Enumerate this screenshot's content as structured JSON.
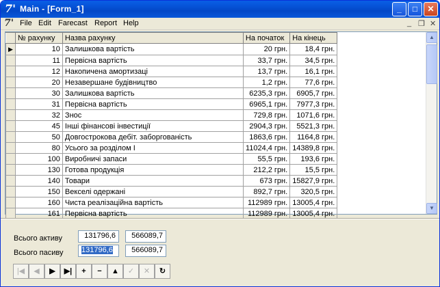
{
  "window": {
    "title": "Main - [Form_1]"
  },
  "titlebar_buttons": {
    "minimize": "_",
    "maximize": "□",
    "close": "✕"
  },
  "menu": {
    "items": [
      "File",
      "Edit",
      "Farecast",
      "Report",
      "Help"
    ]
  },
  "mdi_controls": {
    "minimize": "_",
    "restore": "❐",
    "close": "✕"
  },
  "grid": {
    "columns": [
      "№ рахунку",
      "Назва рахунку",
      "На початок",
      "На кінець"
    ],
    "current_row": 0,
    "rows": [
      [
        "10",
        "Залишкова вартість",
        "20 грн.",
        "18,4 грн."
      ],
      [
        "11",
        "Первісна вартість",
        "33,7 грн.",
        "34,5 грн."
      ],
      [
        "12",
        "Накопичена амортизаці",
        "13,7 грн.",
        "16,1 грн."
      ],
      [
        "20",
        "Незавершане будівництво",
        "1,2 грн.",
        "77,6 грн."
      ],
      [
        "30",
        "Залишкова вартість",
        "6235,3 грн.",
        "6905,7 грн."
      ],
      [
        "31",
        "Первісна вартість",
        "6965,1 грн.",
        "7977,3 грн."
      ],
      [
        "32",
        "Знос",
        "729,8 грн.",
        "1071,6 грн."
      ],
      [
        "45",
        "Інші фінансові інвестиції",
        "2904,3 грн.",
        "5521,3 грн."
      ],
      [
        "50",
        "Довгострокова дебіт. заборгованість",
        "1863,6 грн.",
        "1164,8 грн."
      ],
      [
        "80",
        "Усього за розділом І",
        "11024,4 грн.",
        "14389,8 грн."
      ],
      [
        "100",
        "Виробничі запаси",
        "55,5 грн.",
        "193,6 грн."
      ],
      [
        "130",
        "Готова продукція",
        "212,2 грн.",
        "15,5 грн."
      ],
      [
        "140",
        "Товари",
        "673 грн.",
        "15827,9 грн."
      ],
      [
        "150",
        "Векселі одержані",
        "892,7 грн.",
        "320,5 грн."
      ],
      [
        "160",
        "Чиста реалізаційна вартість",
        "112989 грн.",
        "13005,4 грн."
      ],
      [
        "161",
        "Первісна вартість",
        "112989 грн.",
        "13005,4 грн."
      ]
    ]
  },
  "totals": {
    "assets_label": "Всього активу",
    "assets_start": "131796,6",
    "assets_end": "566089,7",
    "liabilities_label": "Всього пасиву",
    "liabilities_start": "131796,6",
    "liabilities_end": "566089,7"
  },
  "navigator": {
    "first": "|◀",
    "prior": "◀",
    "next": "▶",
    "last": "▶|",
    "insert": "+",
    "delete": "−",
    "edit": "▲",
    "post": "✓",
    "cancel": "✕",
    "refresh": "↻"
  }
}
